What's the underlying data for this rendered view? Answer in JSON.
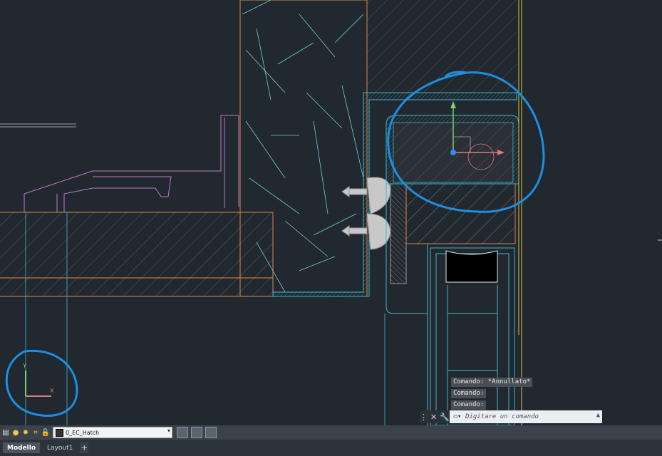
{
  "command_history": [
    "Comando: *Annullato*",
    "Comando:",
    "Comando:"
  ],
  "command_input": {
    "placeholder": "Digitare un comando"
  },
  "layer": {
    "current": "0_EC_Hatch"
  },
  "tabs": [
    {
      "label": "Modello",
      "active": true
    },
    {
      "label": "Layout1",
      "active": false
    },
    {
      "label": "+",
      "active": false
    }
  ],
  "colors": {
    "background": "#212830",
    "magenta": "#c07ac8",
    "cyan": "#3fb7c7",
    "orange": "#d88a4a",
    "yellow": "#d8c23a",
    "annotation": "#1c8fe0"
  },
  "icons": [
    "light-bulb-icon",
    "sun-icon",
    "freeze-icon",
    "lock-icon",
    "layer-color-swatch",
    "close-icon",
    "wrench-icon",
    "command-prompt-icon"
  ]
}
